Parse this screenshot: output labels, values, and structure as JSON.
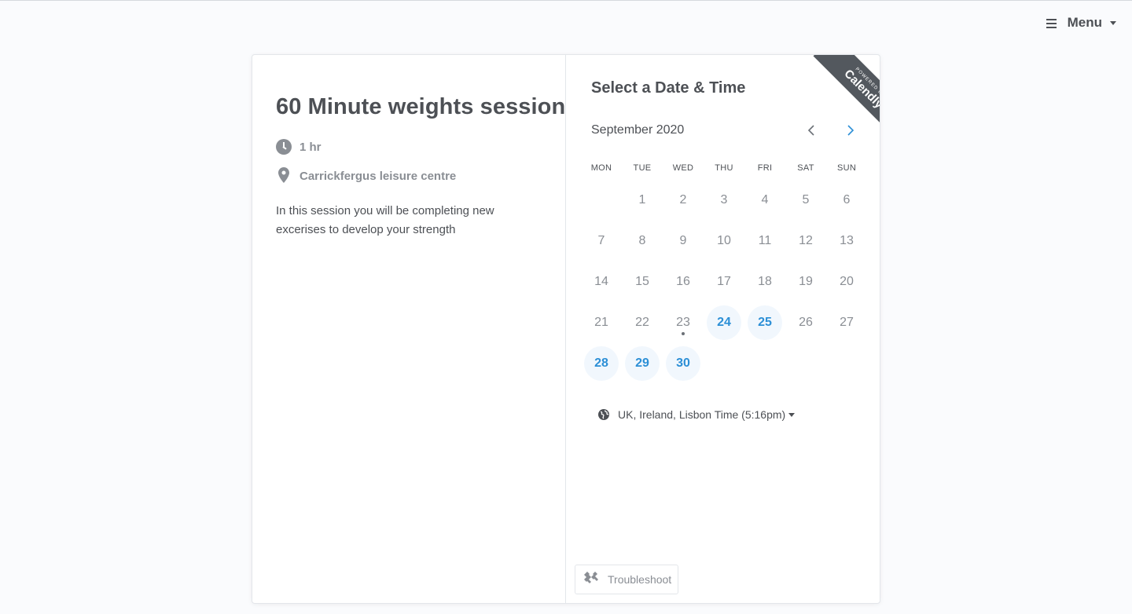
{
  "header": {
    "menu_label": "Menu"
  },
  "event": {
    "title": "60 Minute weights session",
    "duration": "1 hr",
    "location": "Carrickfergus leisure centre",
    "description": "In this session you will be completing new excerises to develop your strength"
  },
  "scheduler": {
    "heading": "Select a Date & Time",
    "ribbon_powered": "POWERED BY",
    "ribbon_brand": "Calendly",
    "month": "September 2020",
    "weekdays": [
      "MON",
      "TUE",
      "WED",
      "THU",
      "FRI",
      "SAT",
      "SUN"
    ],
    "weeks": [
      [
        "",
        "1",
        "2",
        "3",
        "4",
        "5",
        "6"
      ],
      [
        "7",
        "8",
        "9",
        "10",
        "11",
        "12",
        "13"
      ],
      [
        "14",
        "15",
        "16",
        "17",
        "18",
        "19",
        "20"
      ],
      [
        "21",
        "22",
        "23",
        "24",
        "25",
        "26",
        "27"
      ],
      [
        "28",
        "29",
        "30",
        "",
        "",
        "",
        ""
      ]
    ],
    "available_days": [
      "24",
      "25",
      "28",
      "29",
      "30"
    ],
    "today": "23",
    "timezone": "UK, Ireland, Lisbon Time (5:16pm)",
    "troubleshoot_label": "Troubleshoot"
  },
  "colors": {
    "accent": "#2c8fd6",
    "available_bg": "#f1f7fd",
    "ribbon": "#53585e",
    "text": "#4d5055",
    "muted": "#8a8e94"
  }
}
